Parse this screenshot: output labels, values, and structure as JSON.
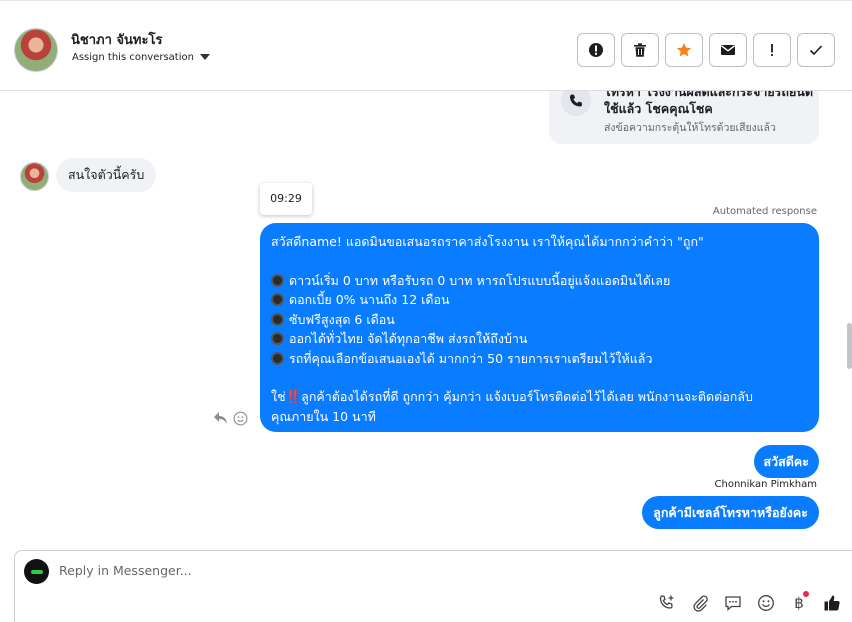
{
  "header": {
    "contact_name": "นิชาภา จันทะโร",
    "assign_label": "Assign this conversation"
  },
  "call_card": {
    "title": "โทรหา โรงงานผลิตและกระจายรถยนต์ใช้แล้ว โชคคุณโชค",
    "subtitle": "ส่งข้อความกระตุ้นให้โทรด้วยเสียงแล้ว"
  },
  "messages": {
    "incoming_1": "สนใจตัวนี้ครับ",
    "timestamp": "09:29",
    "automated_label": "Automated response",
    "auto_reply": {
      "line1": "สวัสดีname! แอดมินขอเสนอรถราคาส่งโรงงาน เราให้คุณได้มากกว่าคำว่า \"ถูก\"",
      "bullets": [
        "ดาวน์เริ่ม 0 บาท หรือรับรถ 0 บาท หารถโปรแบบนี้อยู่แจ้งแอดมินได้เลย",
        "ดอกเบี้ย 0% นานถึง 12 เดือน",
        "ซับฟรีสูงสุด 6 เดือน",
        "ออกได้ทั่วไทย จัดได้ทุกอาชีพ ส่งรถให้ถึงบ้าน",
        "รถที่คุณเลือกข้อเสนอเองได้ มากกว่า 50 รายการเราเตรียมไว้ให้แล้ว"
      ],
      "closing_prefix": "ใช่",
      "closing_mark": "‼️",
      "closing_line1": "ลูกค้าต้องได้รถที่ดี ถูกกว่า คุ้มกว่า แจ้งเบอร์โทรติดต่อไว้ได้เลย พนักงานจะติดต่อกลับ",
      "closing_line2": "คุณภายใน 10 นาที"
    },
    "outgoing_1": "สวัสดีคะ",
    "sender_name": "Chonnikan Pimkham",
    "outgoing_2": "ลูกค้ามีเซลล์โทรหาหรือยังคะ"
  },
  "composer": {
    "placeholder": "Reply in Messenger..."
  },
  "icons": {
    "header_actions": [
      "alert-icon",
      "trash-icon",
      "star-icon",
      "envelope-icon",
      "exclamation-icon",
      "check-icon"
    ],
    "composer_tools": [
      "add-call-icon",
      "attachment-icon",
      "saved-reply-icon",
      "emoji-icon",
      "baht-icon",
      "thumbs-up-icon"
    ]
  },
  "colors": {
    "accent": "#0a7cff",
    "star": "#f5821f",
    "incoming_bubble": "#f0f2f5"
  }
}
